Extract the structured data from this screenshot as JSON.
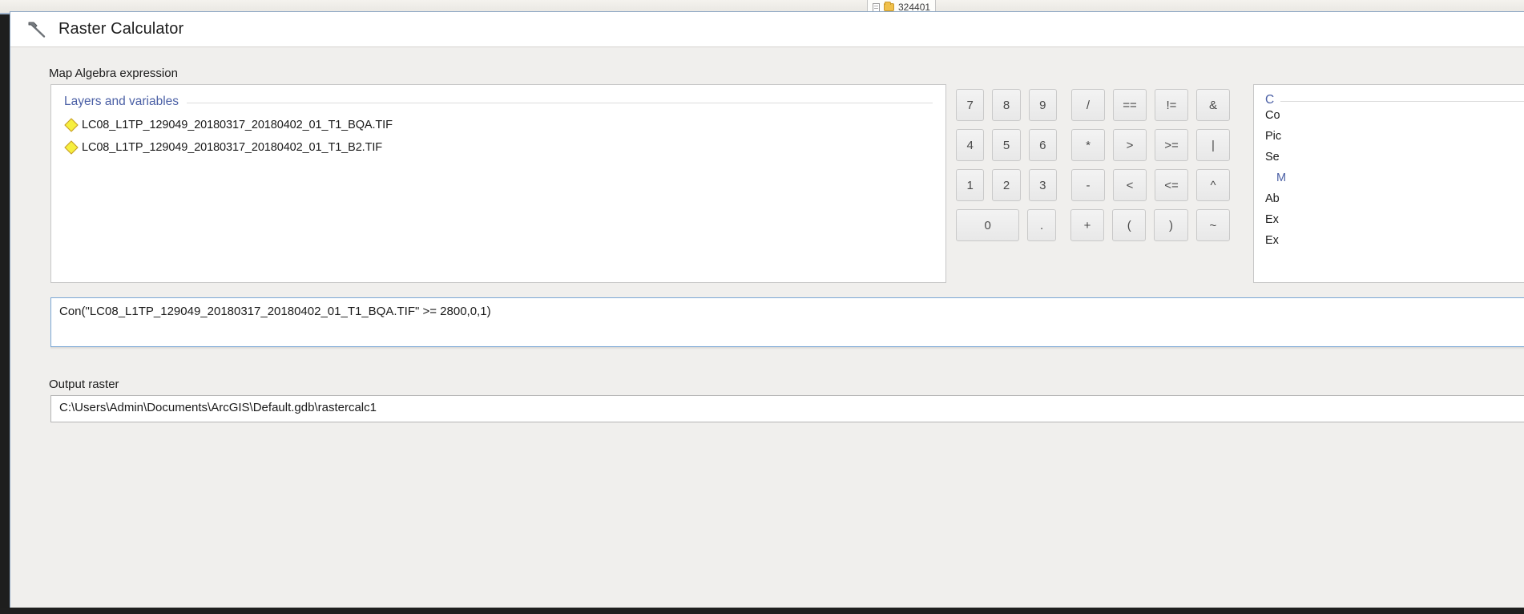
{
  "background": {
    "tab_label": "324401",
    "doc_icon": "document-icon",
    "folder_icon": "folder-icon"
  },
  "window": {
    "title": "Raster Calculator",
    "title_icon": "hammer-tool-icon"
  },
  "map_algebra": {
    "section_label": "Map Algebra expression",
    "layers_panel": {
      "header": "Layers and variables",
      "items": [
        {
          "icon": "raster-layer-diamond-icon",
          "label": "LC08_L1TP_129049_20180317_20180402_01_T1_BQA.TIF"
        },
        {
          "icon": "raster-layer-diamond-icon",
          "label": "LC08_L1TP_129049_20180317_20180402_01_T1_B2.TIF"
        }
      ]
    },
    "keypad": {
      "rows": [
        [
          {
            "label": "7",
            "name": "key-7"
          },
          {
            "label": "8",
            "name": "key-8"
          },
          {
            "label": "9",
            "name": "key-9"
          },
          {
            "label": "/",
            "name": "key-divide"
          },
          {
            "label": "==",
            "name": "key-equal-equal"
          },
          {
            "label": "!=",
            "name": "key-not-equal"
          },
          {
            "label": "&",
            "name": "key-and"
          }
        ],
        [
          {
            "label": "4",
            "name": "key-4"
          },
          {
            "label": "5",
            "name": "key-5"
          },
          {
            "label": "6",
            "name": "key-6"
          },
          {
            "label": "*",
            "name": "key-multiply"
          },
          {
            "label": ">",
            "name": "key-greater-than"
          },
          {
            "label": ">=",
            "name": "key-greater-equal"
          },
          {
            "label": "|",
            "name": "key-or"
          }
        ],
        [
          {
            "label": "1",
            "name": "key-1"
          },
          {
            "label": "2",
            "name": "key-2"
          },
          {
            "label": "3",
            "name": "key-3"
          },
          {
            "label": "-",
            "name": "key-minus"
          },
          {
            "label": "<",
            "name": "key-less-than"
          },
          {
            "label": "<=",
            "name": "key-less-equal"
          },
          {
            "label": "^",
            "name": "key-power"
          }
        ],
        [
          {
            "label": "0",
            "name": "key-0"
          },
          {
            "label": ".",
            "name": "key-decimal"
          },
          {
            "label": "+",
            "name": "key-plus"
          },
          {
            "label": "(",
            "name": "key-open-paren"
          },
          {
            "label": ")",
            "name": "key-close-paren"
          },
          {
            "label": "~",
            "name": "key-not"
          }
        ]
      ]
    },
    "functions_panel": {
      "header": "C",
      "items": [
        "Co",
        "Pic",
        "Se"
      ],
      "group": "M",
      "more": [
        "Ab",
        "Ex",
        "Ex"
      ]
    },
    "expression": "Con(\"LC08_L1TP_129049_20180317_20180402_01_T1_BQA.TIF\" >= 2800,0,1)"
  },
  "output": {
    "section_label": "Output raster",
    "value": "C:\\Users\\Admin\\Documents\\ArcGIS\\Default.gdb\\rastercalc1"
  }
}
